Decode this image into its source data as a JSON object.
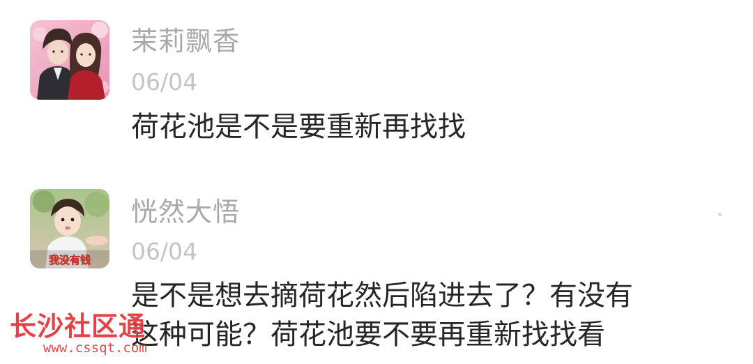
{
  "comments": [
    {
      "username": "茉莉飘香",
      "date": "06/04",
      "lines": [
        "荷花池是不是要重新再找找"
      ],
      "avatar_icon": "couple-photo-avatar"
    },
    {
      "username": "恍然大悟",
      "date": "06/04",
      "lines": [
        "是不是想去摘荷花然后陷进去了？有没有",
        "这种可能？荷花池要不要再重新找找看"
      ],
      "avatar_icon": "child-photo-avatar",
      "avatar_caption": "我没有钱"
    }
  ],
  "watermark": {
    "text": "长沙社区通",
    "url": "www.cssqt.com"
  },
  "colors": {
    "username": "#a9a9a9",
    "date": "#c4c4c4",
    "content": "#262626",
    "watermark": "#e0343a"
  }
}
